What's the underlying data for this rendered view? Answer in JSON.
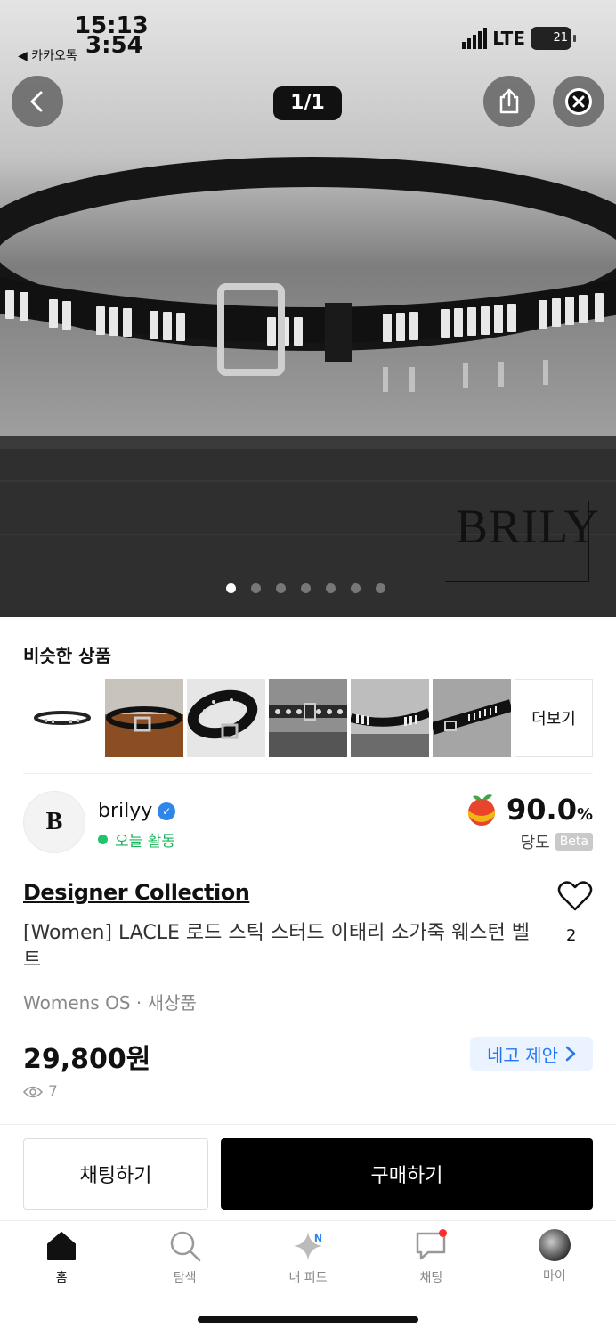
{
  "status_bar": {
    "time_top": "15:13",
    "time_bottom": "3:54",
    "back_app": "◀ 카카오톡",
    "network": "LTE",
    "battery": "21"
  },
  "gallery": {
    "counter": "1/1",
    "dots_total": 7,
    "dots_active": 0,
    "watermark": "BRILY"
  },
  "similar": {
    "title": "비슷한 상품",
    "more_label": "더보기"
  },
  "seller": {
    "avatar_letter": "B",
    "name": "brilyy",
    "activity": "오늘 활동",
    "score": "90.0",
    "score_unit": "%",
    "score_label": "당도",
    "beta": "Beta"
  },
  "product": {
    "brand": "Designer Collection",
    "title": "[Women] LACLE 로드 스틱 스터드 이태리 소가죽 웨스턴 벨트",
    "likes": "2",
    "meta": "Womens OS · 새상품",
    "price": "29,800원",
    "offer_label": "네고 제안",
    "views": "7"
  },
  "actions": {
    "chat": "채팅하기",
    "buy": "구매하기"
  },
  "tabbar": {
    "items": [
      {
        "label": "홈"
      },
      {
        "label": "탐색"
      },
      {
        "label": "내 피드",
        "badge": "N"
      },
      {
        "label": "채팅"
      },
      {
        "label": "마이"
      }
    ]
  },
  "colors": {
    "accent_blue": "#2377f0",
    "active_green": "#19b35a",
    "buy_black": "#000000"
  }
}
